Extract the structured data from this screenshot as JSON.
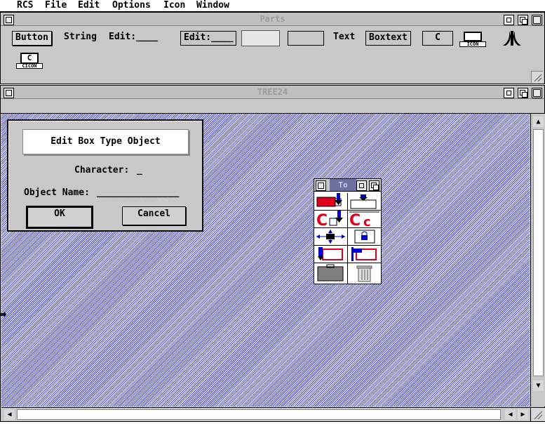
{
  "menubar": {
    "items": [
      "RCS",
      "File",
      "Edit",
      "Options",
      "Icon",
      "Window"
    ]
  },
  "parts_window": {
    "title": "Parts",
    "parts": {
      "button": "Button",
      "string": "String",
      "edit": "Edit:____",
      "edit_boxed": "Edit:____",
      "text": "Text",
      "boxtext": "Boxtext",
      "boxchar": "C",
      "icon_label": "ICON",
      "cicon_char": "C",
      "cicon_label": "CICON"
    }
  },
  "tree_window": {
    "title": "TREE24"
  },
  "dialog": {
    "title": "Edit Box Type Object",
    "character_label": "Character:",
    "character_value": "_",
    "object_name_label": "Object Name:",
    "object_name_value": "_______________",
    "ok_label": "OK",
    "cancel_label": "Cancel"
  },
  "toolbox": {
    "title": "To",
    "tools": [
      "paste-object",
      "insert-object",
      "copy-object",
      "copy-char",
      "move-resize",
      "lock",
      "paste-into",
      "flag-object",
      "container",
      "trash"
    ]
  },
  "colors": {
    "desktop_pattern": "#4848c8",
    "window_gray": "#c8c8c8",
    "accent_red": "#e0001c",
    "accent_blue": "#0000c8"
  }
}
